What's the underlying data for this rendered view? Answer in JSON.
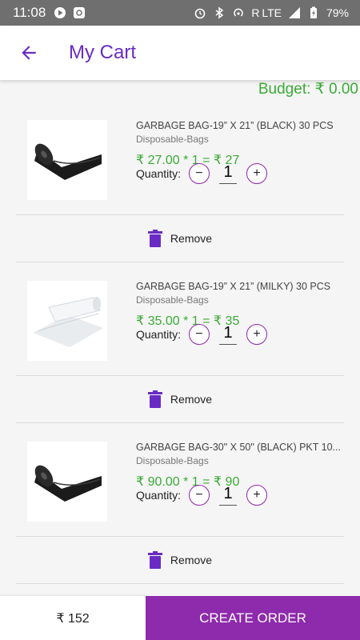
{
  "status": {
    "time": "11:08",
    "network": "R LTE",
    "battery": "79%"
  },
  "header": {
    "title": "My Cart"
  },
  "budget": "Budget: ₹ 0.00",
  "items": [
    {
      "name": "GARBAGE BAG-19” X 21” (BLACK) 30 PCS",
      "category": "Disposable-Bags",
      "price_line": "₹ 27.00 * 1 = ₹ 27",
      "quantity_label": "Quantity:",
      "quantity": "1",
      "remove_label": "Remove",
      "image": "black-garbage-bag-roll"
    },
    {
      "name": "GARBAGE BAG-19” X 21” (MILKY) 30 PCS",
      "category": "Disposable-Bags",
      "price_line": "₹ 35.00 * 1 = ₹ 35",
      "quantity_label": "Quantity:",
      "quantity": "1",
      "remove_label": "Remove",
      "image": "milky-garbage-bag-roll"
    },
    {
      "name": "GARBAGE BAG-30\" X 50\" (BLACK) PKT 10...",
      "category": "Disposable-Bags",
      "price_line": "₹ 90.00 * 1 = ₹ 90",
      "quantity_label": "Quantity:",
      "quantity": "1",
      "remove_label": "Remove",
      "image": "black-garbage-bag-roll"
    }
  ],
  "footer": {
    "total": "₹ 152",
    "create_label": "CREATE ORDER"
  },
  "colors": {
    "accent": "#6a2bc4",
    "price": "#3aaa35",
    "button": "#8e2aac"
  }
}
